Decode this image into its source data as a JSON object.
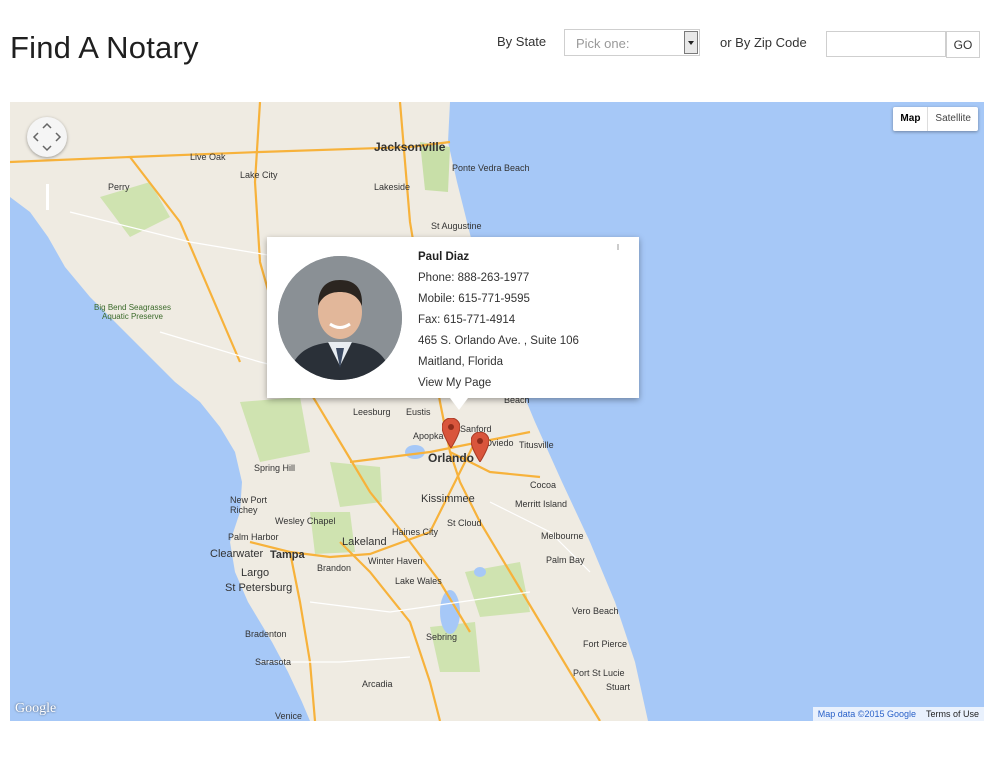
{
  "header": {
    "title": "Find A Notary",
    "state_label": "By State",
    "state_select_value": "Pick one:",
    "zip_label": "or By Zip Code",
    "zip_value": "",
    "go_label": "GO"
  },
  "map": {
    "map_type_options": [
      "Map",
      "Satellite"
    ],
    "map_type_selected": "Map",
    "attribution_data": "Map data ©2015 Google",
    "terms_label": "Terms of Use",
    "logo": "Google",
    "place_labels": {
      "jacksonville": "Jacksonville",
      "ponte_vedra": "Ponte Vedra Beach",
      "live_oak": "Live Oak",
      "lake_city": "Lake City",
      "perry": "Perry",
      "lakeside": "Lakeside",
      "st_augustine": "St Augustine",
      "big_bend": "Big Bend Seagrasses Aquatic Preserve",
      "leesburg": "Leesburg",
      "eustis": "Eustis",
      "apopka": "Apopka",
      "sanford": "Sanford",
      "oviedo": "Oviedo",
      "titusville": "Titusville",
      "orlando": "Orlando",
      "cocoa": "Cocoa",
      "spring_hill": "Spring Hill",
      "new_port_richey": "New Port Richey",
      "wesley_chapel": "Wesley Chapel",
      "kissimmee": "Kissimmee",
      "merritt_island": "Merritt Island",
      "st_cloud": "St Cloud",
      "palm_harbor": "Palm Harbor",
      "clearwater": "Clearwater",
      "tampa": "Tampa",
      "lakeland": "Lakeland",
      "haines_city": "Haines City",
      "melbourne": "Melbourne",
      "largo": "Largo",
      "brandon": "Brandon",
      "winter_haven": "Winter Haven",
      "palm_bay": "Palm Bay",
      "st_petersburg": "St Petersburg",
      "lake_wales": "Lake Wales",
      "vero_beach": "Vero Beach",
      "bradenton": "Bradenton",
      "sebring": "Sebring",
      "fort_pierce": "Fort Pierce",
      "sarasota": "Sarasota",
      "port_st_lucie": "Port St Lucie",
      "stuart": "Stuart",
      "arcadia": "Arcadia",
      "venice": "Venice",
      "deland_beach": "Beach"
    },
    "pins": [
      {
        "name": "Notary pin A",
        "color": "#d9553c"
      },
      {
        "name": "Notary pin B",
        "color": "#d9553c"
      }
    ],
    "colors": {
      "water": "#a6c8f7",
      "land": "#efebe2",
      "park": "#c8dfa8",
      "highway": "#f7b23b",
      "road": "#ffffff"
    }
  },
  "notary_card": {
    "name": "Paul Diaz",
    "phone": "Phone: 888-263-1977",
    "mobile": "Mobile: 615-771-9595",
    "fax": "Fax: 615-771-4914",
    "address": "465 S. Orlando Ave. , Suite 106",
    "city": "Maitland, Florida",
    "link": "View My Page"
  }
}
